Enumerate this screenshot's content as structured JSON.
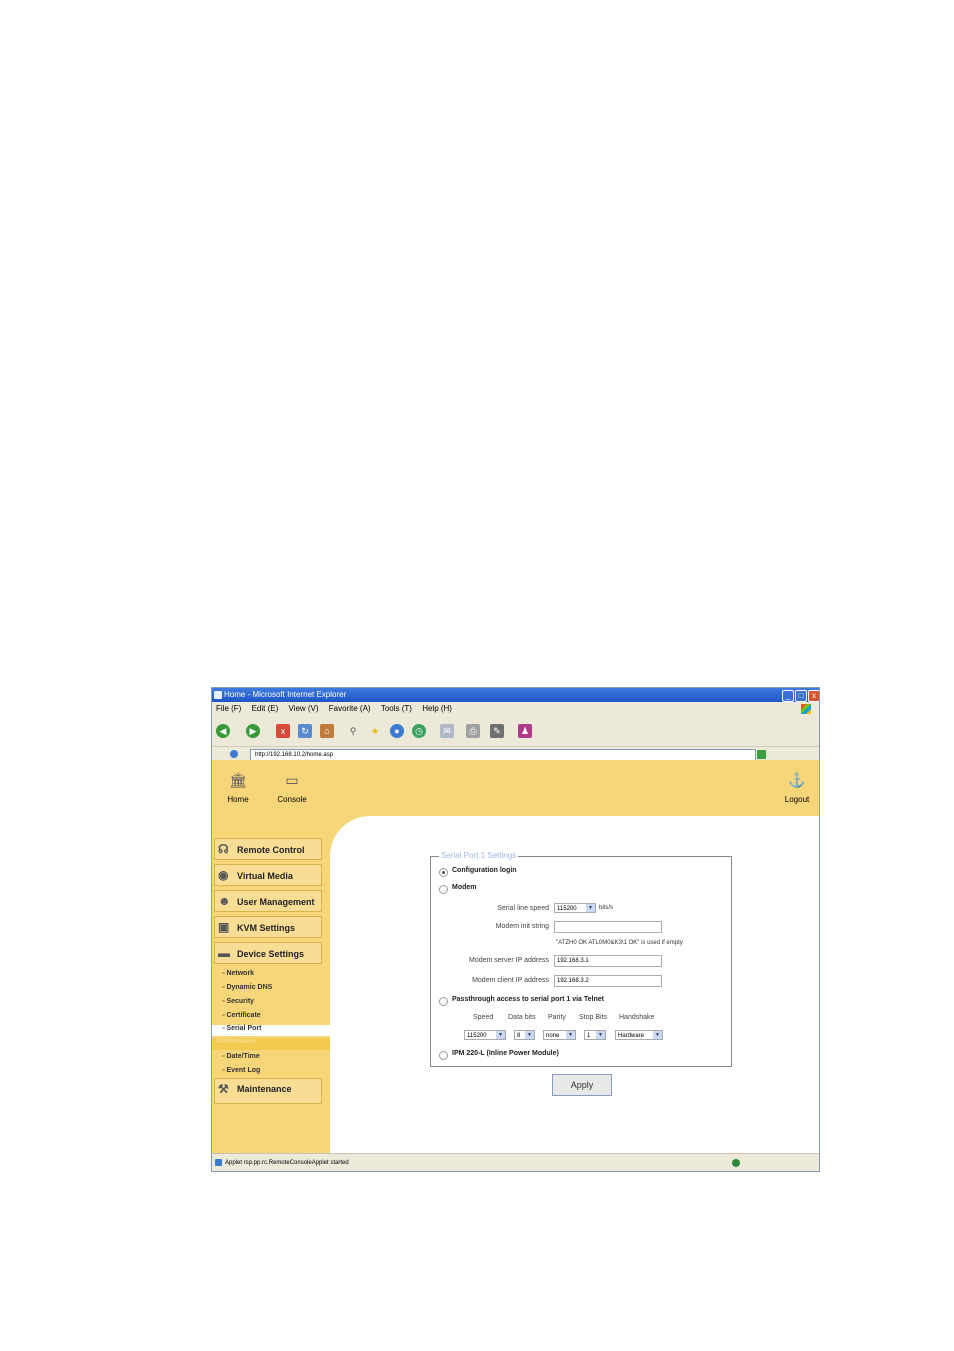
{
  "window": {
    "title": "Home - Microsoft Internet Explorer",
    "controls": [
      "_",
      "□",
      "x"
    ]
  },
  "menu": [
    "File (F)",
    "Edit (E)",
    "View (V)",
    "Favorite (A)",
    "Tools (T)",
    "Help (H)"
  ],
  "toolbar_icons": [
    "back-icon",
    "forward-icon",
    "stop-icon",
    "refresh-icon",
    "home-icon",
    "search-icon",
    "favorites-icon",
    "media-icon",
    "history-icon",
    "mail-icon",
    "print-icon",
    "edit-icon",
    "messenger-icon"
  ],
  "address": {
    "url": "http://192.168.10.2/home.asp"
  },
  "header": {
    "home": "Home",
    "console": "Console",
    "logout": "Logout"
  },
  "sidebar": {
    "items": [
      {
        "label": "Remote Control",
        "icon": "remote-control-icon"
      },
      {
        "label": "Virtual Media",
        "icon": "virtual-media-icon"
      },
      {
        "label": "User Management",
        "icon": "user-management-icon"
      },
      {
        "label": "KVM Settings",
        "icon": "kvm-settings-icon"
      },
      {
        "label": "Device Settings",
        "icon": "device-settings-icon"
      }
    ],
    "device_subitems": [
      "Network",
      "Dynamic DNS",
      "Security",
      "Certificate",
      "Serial Port"
    ],
    "group_label": "Maintenance",
    "maintenance_subitems": [
      "Date/Time",
      "Event Log"
    ],
    "maintenance": {
      "label": "Maintenance",
      "icon": "maintenance-icon"
    }
  },
  "form": {
    "legend": "Serial Port 1 Settings",
    "options": {
      "config_login": "Configuration login",
      "modem": "Modem",
      "passthrough": "Passthrough access to serial port 1 via Telnet",
      "ipm": "IPM 220-L (Inline Power Module)"
    },
    "serial_speed_label": "Serial line speed",
    "serial_speed_value": "115200",
    "serial_speed_unit": "bits/s",
    "modem_init_label": "Modem init string",
    "modem_init_value": "",
    "modem_init_note": "\"ATZH0 OK ATL0M0&K3\\1 OK\" is used if empty",
    "modem_server_label": "Modem server IP address",
    "modem_server_value": "192.168.3.1",
    "modem_client_label": "Modem client IP address",
    "modem_client_value": "192.168.3.2",
    "telnet_headers": [
      "Speed",
      "Data bits",
      "Parity",
      "Stop Bits",
      "Handshake"
    ],
    "telnet_values": [
      "115200",
      "8",
      "none",
      "1",
      "Hardware"
    ],
    "apply": "Apply"
  },
  "status": {
    "text": "Applet rsp.pp.rc.RemoteConsoleApplet started"
  }
}
